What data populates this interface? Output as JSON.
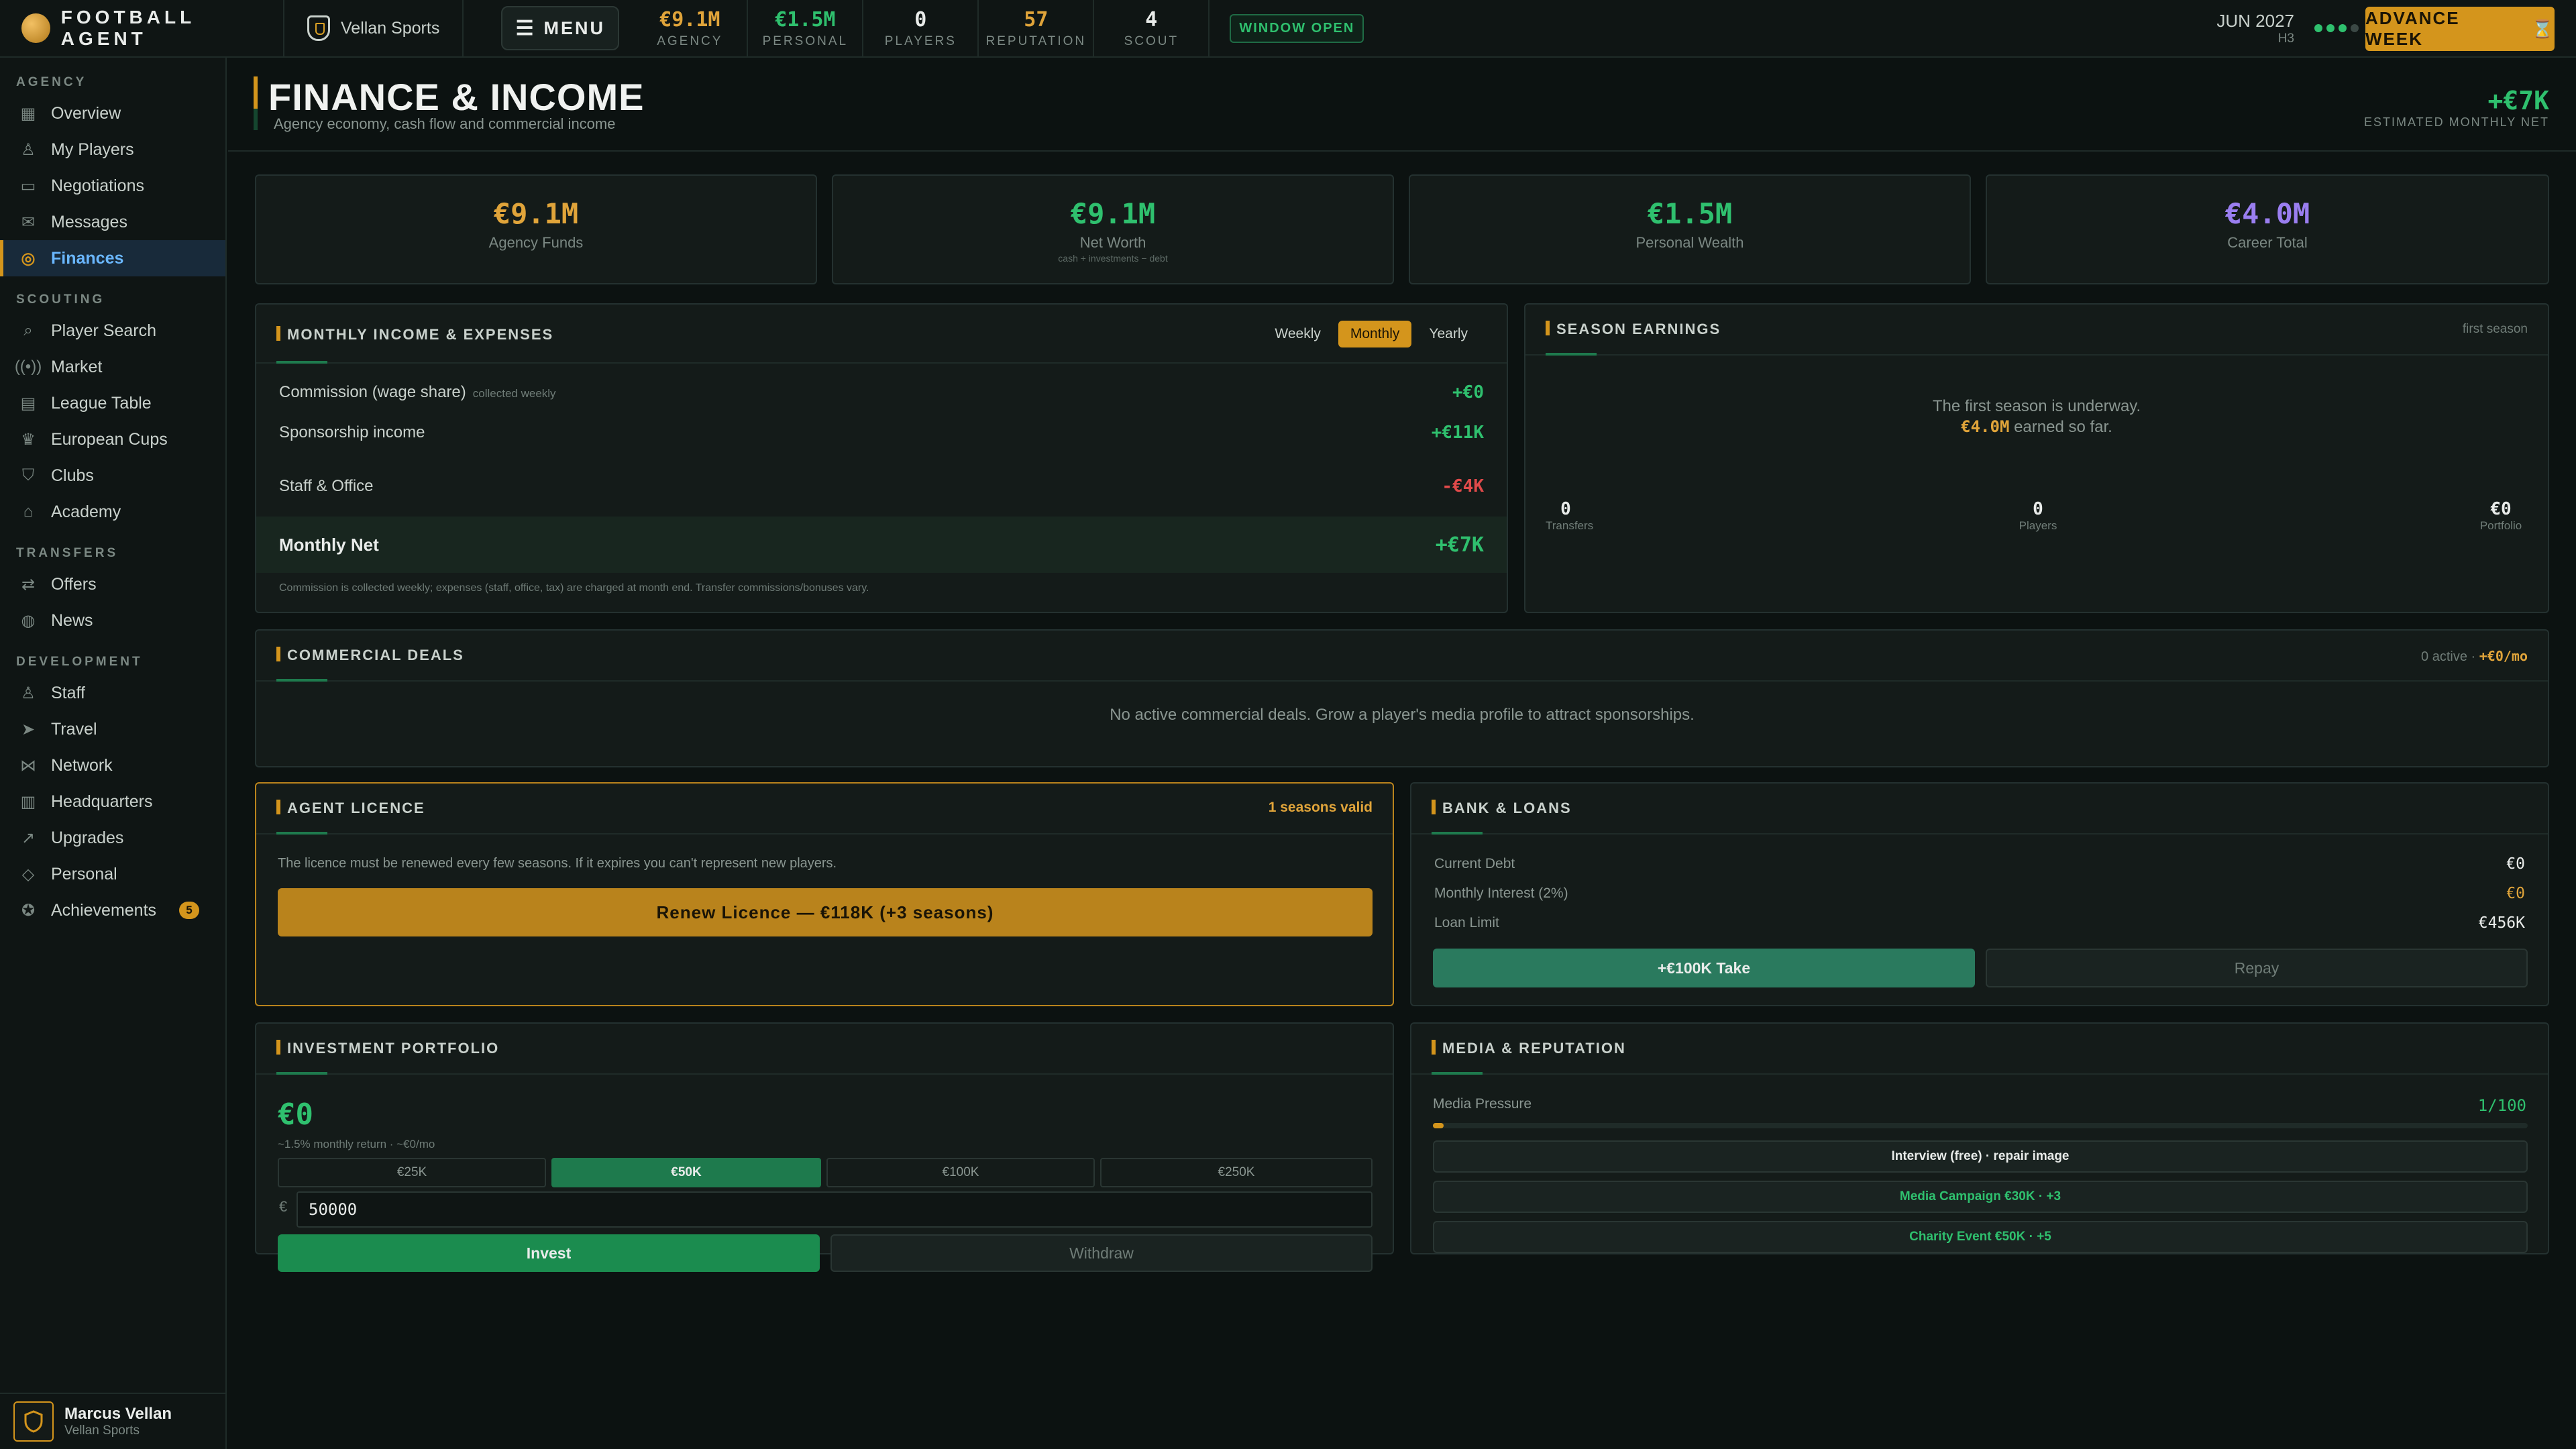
{
  "topbar": {
    "brand": "FOOTBALL AGENT",
    "agency": "Vellan Sports",
    "menu_label": "MENU",
    "stats": [
      {
        "value": "€9.1M",
        "label": "AGENCY",
        "color": "#e0a43a"
      },
      {
        "value": "€1.5M",
        "label": "PERSONAL",
        "color": "#2fc06e"
      },
      {
        "value": "0",
        "label": "PLAYERS",
        "color": "#e9ecea"
      },
      {
        "value": "57",
        "label": "REPUTATION",
        "color": "#e0a43a"
      },
      {
        "value": "4",
        "label": "SCOUT",
        "color": "#e9ecea"
      }
    ],
    "window_badge": "WINDOW OPEN",
    "date": "JUN 2027",
    "date_sub": "H3",
    "advance_label": "ADVANCE WEEK"
  },
  "sidebar": {
    "sections": [
      {
        "title": "AGENCY",
        "items": [
          "Overview",
          "My Players",
          "Negotiations",
          "Messages",
          "Finances"
        ]
      },
      {
        "title": "SCOUTING",
        "items": [
          "Player Search",
          "Market",
          "League Table",
          "European Cups",
          "Clubs",
          "Academy"
        ]
      },
      {
        "title": "TRANSFERS",
        "items": [
          "Offers",
          "News"
        ]
      },
      {
        "title": "DEVELOPMENT",
        "items": [
          "Staff",
          "Travel",
          "Network",
          "Headquarters",
          "Upgrades",
          "Personal",
          "Achievements"
        ]
      }
    ],
    "active": "Finances",
    "achievements_badge": "5",
    "user_name": "Marcus Vellan",
    "user_agency": "Vellan Sports"
  },
  "header": {
    "title": "FINANCE & INCOME",
    "subtitle": "Agency economy, cash flow and commercial income",
    "net_value": "+€7K",
    "net_label": "ESTIMATED MONTHLY NET"
  },
  "kpis": [
    {
      "value": "€9.1M",
      "label": "Agency Funds",
      "sub": "",
      "color": "#e0a43a"
    },
    {
      "value": "€9.1M",
      "label": "Net Worth",
      "sub": "cash + investments − debt",
      "color": "#2fc06e"
    },
    {
      "value": "€1.5M",
      "label": "Personal Wealth",
      "sub": "",
      "color": "#2fc06e"
    },
    {
      "value": "€4.0M",
      "label": "Career Total",
      "sub": "",
      "color": "#9a7ef0"
    }
  ],
  "monthly": {
    "title": "MONTHLY INCOME & EXPENSES",
    "periods": [
      "Weekly",
      "Monthly",
      "Yearly"
    ],
    "active_period": "Monthly",
    "rows": [
      {
        "label": "Commission (wage share)",
        "note": "collected weekly",
        "value": "+€0"
      },
      {
        "label": "Sponsorship income",
        "note": "",
        "value": "+€11K"
      },
      {
        "label": "Staff & Office",
        "note": "",
        "value": "-€4K"
      }
    ],
    "net_label": "Monthly Net",
    "net_value": "+€7K",
    "footnote": "Commission is collected weekly; expenses (staff, office, tax) are charged at month end. Transfer commissions/bonuses vary."
  },
  "season": {
    "title": "SEASON EARNINGS",
    "tag": "first season",
    "line1": "The first season is underway.",
    "amount": "€4.0M",
    "line2_suffix": "earned so far.",
    "stats": [
      {
        "value": "0",
        "label": "Transfers"
      },
      {
        "value": "0",
        "label": "Players"
      },
      {
        "value": "€0",
        "label": "Portfolio"
      }
    ]
  },
  "commercial": {
    "title": "COMMERCIAL DEALS",
    "active_count": "0 active",
    "per_month": "+€0/mo",
    "empty": "No active commercial deals. Grow a player's media profile to attract sponsorships."
  },
  "licence": {
    "title": "AGENT LICENCE",
    "validity": "1 seasons valid",
    "text": "The licence must be renewed every few seasons. If it expires you can't represent new players.",
    "renew_label": "Renew Licence — €118K (+3 seasons)"
  },
  "bank": {
    "title": "BANK & LOANS",
    "rows": [
      {
        "label": "Current Debt",
        "value": "€0",
        "color": "#e9ecea"
      },
      {
        "label": "Monthly Interest (2%)",
        "value": "€0",
        "color": "#e0a43a"
      },
      {
        "label": "Loan Limit",
        "value": "€456K",
        "color": "#e9ecea"
      }
    ],
    "take_label": "+€100K Take",
    "repay_label": "Repay"
  },
  "investment": {
    "title": "INVESTMENT PORTFOLIO",
    "value": "€0",
    "return_text": "~1.5% monthly return · ~€0/mo",
    "amounts": [
      "€25K",
      "€50K",
      "€100K",
      "€250K"
    ],
    "selected_amount": "€50K",
    "currency": "€",
    "input_value": "50000",
    "invest_label": "Invest",
    "withdraw_label": "Withdraw"
  },
  "media": {
    "title": "MEDIA & REPUTATION",
    "pressure_label": "Media Pressure",
    "pressure_value": "1/100",
    "pressure_fraction": 0.01,
    "actions": [
      {
        "label": "Interview (free) · repair image",
        "color": "#e9ecea"
      },
      {
        "label": "Media Campaign €30K · +3",
        "color": "#2fc06e"
      },
      {
        "label": "Charity Event €50K · +5",
        "color": "#2fc06e"
      }
    ]
  }
}
